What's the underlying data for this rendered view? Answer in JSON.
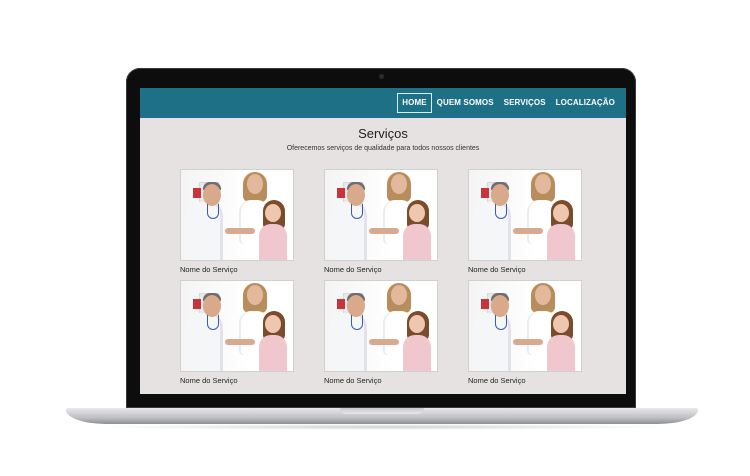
{
  "nav": {
    "items": [
      {
        "label": "HOME",
        "active": true
      },
      {
        "label": "QUEM SOMOS",
        "active": false
      },
      {
        "label": "SERVIÇOS",
        "active": false
      },
      {
        "label": "LOCALIZAÇÃO",
        "active": false
      }
    ]
  },
  "section": {
    "title": "Serviços",
    "subtitle": "Oferecemos serviços de qualidade para todos nossos clientes"
  },
  "services": [
    {
      "label": "Nome do Serviço"
    },
    {
      "label": "Nome do Serviço"
    },
    {
      "label": "Nome do Serviço"
    },
    {
      "label": "Nome do Serviço"
    },
    {
      "label": "Nome do Serviço"
    },
    {
      "label": "Nome do Serviço"
    }
  ],
  "colors": {
    "nav_bg": "#1d7086",
    "page_bg": "#e6e2e2",
    "nav_text": "#ffffff"
  }
}
